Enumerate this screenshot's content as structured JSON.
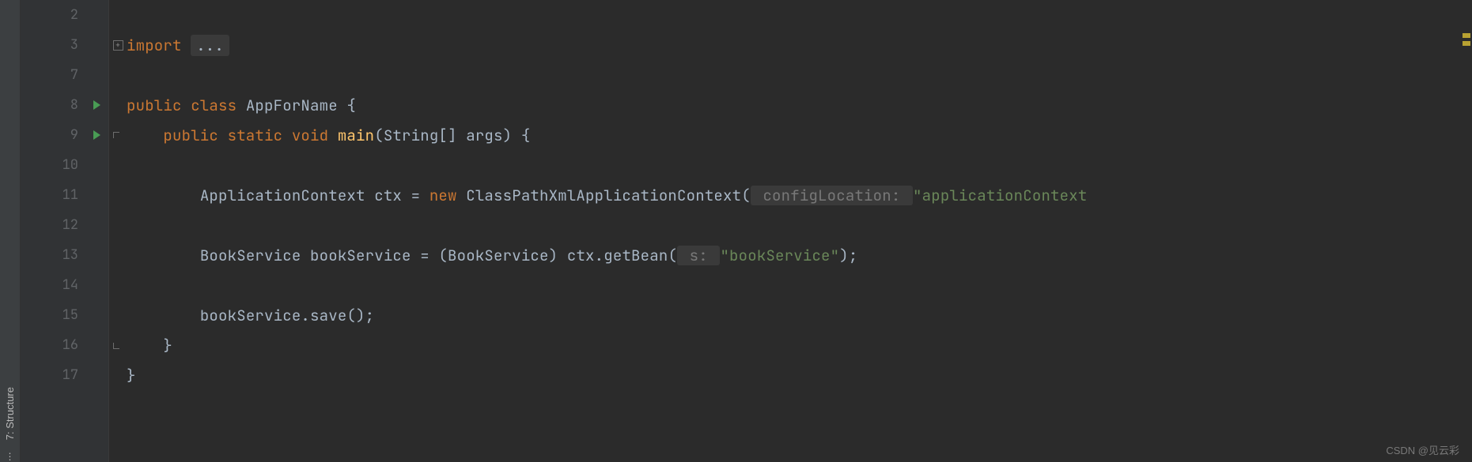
{
  "tool_windows": {
    "structure": "7: Structure",
    "more": "⋮"
  },
  "line_numbers": [
    "2",
    "3",
    "7",
    "8",
    "9",
    "10",
    "11",
    "12",
    "13",
    "14",
    "15",
    "16",
    "17"
  ],
  "run_gutter_rows": [
    3,
    4
  ],
  "fold_markers": {
    "row_1_plus": true,
    "row_4_open": true,
    "row_11_close": true
  },
  "code": {
    "r0": "",
    "r1_import": "import ",
    "r1_collapsed": "...",
    "r2": "",
    "r3_k1": "public class ",
    "r3_ty": "AppForName ",
    "r3_b": "{",
    "r4_k1": "public static ",
    "r4_k2": "void ",
    "r4_fn": "main",
    "r4_sig": "(String[] args) {",
    "r5": "",
    "r6_ty1": "ApplicationContext ",
    "r6_var": "ctx ",
    "r6_eq": "= ",
    "r6_new": "new ",
    "r6_ty2": "ClassPathXmlApplicationContext(",
    "r6_hint": " configLocation: ",
    "r6_str": "\"applicationContext",
    "r7": "",
    "r8_ty1": "BookService ",
    "r8_var": "bookService ",
    "r8_eq": "= (",
    "r8_ty2": "BookService",
    "r8_rest": ") ctx.getBean(",
    "r8_hint": " s: ",
    "r8_str": "\"bookService\"",
    "r8_end": ");",
    "r9": "",
    "r10": "bookService.save();",
    "r11": "}",
    "r12": "}",
    "indent1": "    ",
    "indent2": "        "
  },
  "watermark": "CSDN @见云彩"
}
